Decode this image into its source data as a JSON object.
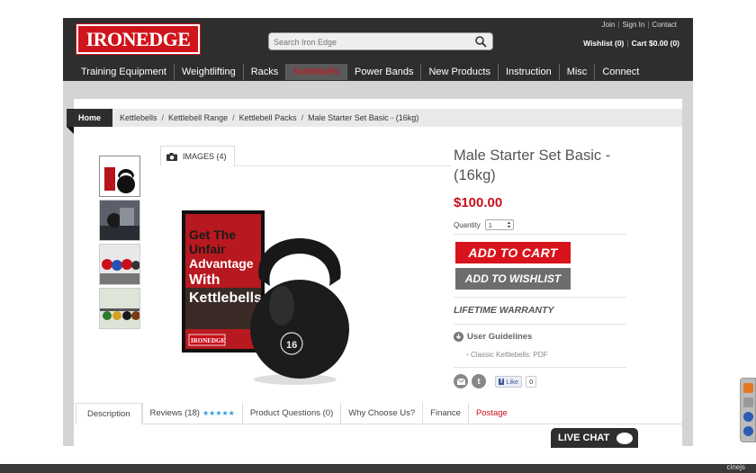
{
  "header": {
    "logo_text": "IRONEDGE",
    "search_placeholder": "Search Iron Edge",
    "top_links": [
      "Join",
      "Sign In",
      "Contact"
    ],
    "wishlist": "Wishlist (0)",
    "cart": "Cart $0.00 (0)"
  },
  "nav": [
    "Training Equipment",
    "Weightlifting",
    "Racks",
    "Kettlebells",
    "Power Bands",
    "New Products",
    "Instruction",
    "Misc",
    "Connect"
  ],
  "breadcrumb": {
    "home": "Home",
    "items": [
      "Kettlebells",
      "Kettlebell Range",
      "Kettlebell Packs",
      "Male Starter Set Basic - (16kg)"
    ],
    "separator": "/"
  },
  "gallery": {
    "tab_label": "IMAGES (4)",
    "dvd_text": [
      "Get The",
      "Unfair",
      "Advantage",
      "With",
      "Kettlebells"
    ],
    "dvd_logo": "IRONEDGE",
    "kettlebell_label": "16"
  },
  "product": {
    "title": "Male Starter Set Basic - (16kg)",
    "price": "$100.00",
    "quantity_label": "Quantity",
    "quantity_value": "1",
    "add_to_cart": "ADD TO CART",
    "add_to_wishlist": "ADD TO WISHLIST",
    "warranty": "LIFETIME WARRANTY",
    "guidelines": "User Guidelines",
    "pdf_link": "Classic Kettlebells: PDF",
    "like_label": "Like",
    "like_count": "0"
  },
  "tabs": [
    {
      "label": "Description"
    },
    {
      "label": "Reviews (18)",
      "stars": "★★★★★"
    },
    {
      "label": "Product Questions (0)"
    },
    {
      "label": "Why Choose Us?"
    },
    {
      "label": "Finance"
    },
    {
      "label": "Postage"
    }
  ],
  "live_chat": "LIVE CHAT",
  "recorder_brand": "cinejs",
  "colors": {
    "brand_red": "#d0141c",
    "header_dark": "#2e2e2e",
    "star_blue": "#2f9edb"
  }
}
